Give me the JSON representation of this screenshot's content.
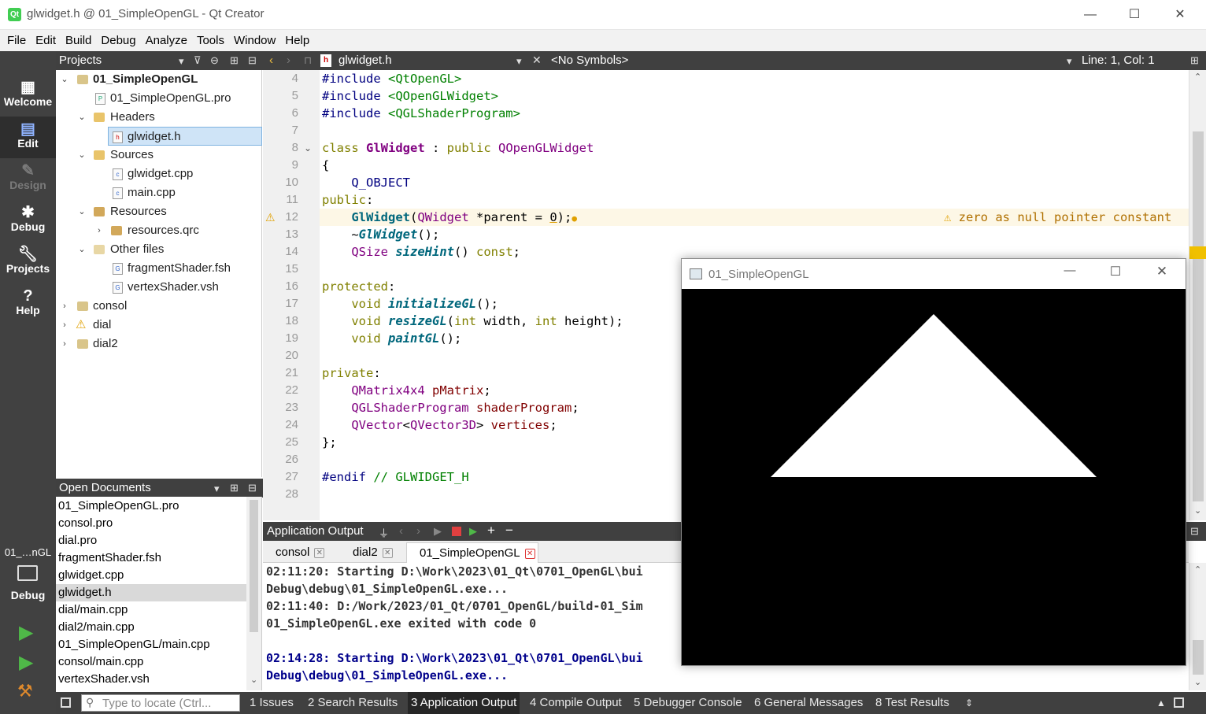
{
  "window": {
    "title": "glwidget.h @ 01_SimpleOpenGL - Qt Creator",
    "app_icon_text": "Qt"
  },
  "menu": [
    "File",
    "Edit",
    "Build",
    "Debug",
    "Analyze",
    "Tools",
    "Window",
    "Help"
  ],
  "modes": [
    {
      "label": "Welcome",
      "icon": "grid-icon"
    },
    {
      "label": "Edit",
      "icon": "edit-icon"
    },
    {
      "label": "Design",
      "icon": "pencil-icon"
    },
    {
      "label": "Debug",
      "icon": "bug-icon"
    },
    {
      "label": "Projects",
      "icon": "wrench-icon"
    },
    {
      "label": "Help",
      "icon": "help-icon"
    }
  ],
  "kit_selector": {
    "project": "01_…nGL",
    "mode": "Debug"
  },
  "projects_panel": {
    "title": "Projects",
    "tree": [
      {
        "label": "01_SimpleOpenGL",
        "level": 0,
        "bold": true,
        "expanded": true
      },
      {
        "label": "01_SimpleOpenGL.pro",
        "level": 1
      },
      {
        "label": "Headers",
        "level": 1,
        "expanded": true
      },
      {
        "label": "glwidget.h",
        "level": 2,
        "selected": true
      },
      {
        "label": "Sources",
        "level": 1,
        "expanded": true
      },
      {
        "label": "glwidget.cpp",
        "level": 2
      },
      {
        "label": "main.cpp",
        "level": 2
      },
      {
        "label": "Resources",
        "level": 1,
        "expanded": true
      },
      {
        "label": "resources.qrc",
        "level": 2
      },
      {
        "label": "Other files",
        "level": 1,
        "expanded": true
      },
      {
        "label": "fragmentShader.fsh",
        "level": 2
      },
      {
        "label": "vertexShader.vsh",
        "level": 2
      },
      {
        "label": "consol",
        "level": 0
      },
      {
        "label": "dial",
        "level": 0,
        "warning": true
      },
      {
        "label": "dial2",
        "level": 0
      }
    ]
  },
  "open_documents": {
    "title": "Open Documents",
    "items": [
      "01_SimpleOpenGL.pro",
      "consol.pro",
      "dial.pro",
      "fragmentShader.fsh",
      "glwidget.cpp",
      "glwidget.h",
      "dial/main.cpp",
      "dial2/main.cpp",
      "01_SimpleOpenGL/main.cpp",
      "consol/main.cpp",
      "vertexShader.vsh"
    ],
    "selected": "glwidget.h"
  },
  "editor_toolbar": {
    "file": "glwidget.h",
    "symbols": "<No Symbols>",
    "position": "Line: 1, Col: 1"
  },
  "editor": {
    "line_numbers": [
      "4",
      "5",
      "6",
      "7",
      "8",
      "9",
      "10",
      "11",
      "12",
      "13",
      "14",
      "15",
      "16",
      "17",
      "18",
      "19",
      "20",
      "21",
      "22",
      "23",
      "24",
      "25",
      "26",
      "27",
      "28"
    ],
    "warning_text": "zero as null pointer constant"
  },
  "output_pane": {
    "title": "Application Output",
    "tabs": [
      "consol",
      "dial2",
      "01_SimpleOpenGL"
    ],
    "lines": [
      {
        "text": "02:11:20: Starting D:\\Work\\2023\\01_Qt\\0701_OpenGL\\bui",
        "color": "#333333"
      },
      {
        "text": "Debug\\debug\\01_SimpleOpenGL.exe...",
        "color": "#333333"
      },
      {
        "text": "02:11:40: D:/Work/2023/01_Qt/0701_OpenGL/build-01_Sim",
        "color": "#333333"
      },
      {
        "text": "01_SimpleOpenGL.exe exited with code 0",
        "color": "#333333"
      },
      {
        "text": "",
        "color": "#333333"
      },
      {
        "text": "02:14:28: Starting D:\\Work\\2023\\01_Qt\\0701_OpenGL\\bui",
        "color": "#00008b"
      },
      {
        "text": "Debug\\debug\\01_SimpleOpenGL.exe...",
        "color": "#00008b"
      }
    ]
  },
  "status_bar": {
    "locator_placeholder": "Type to locate (Ctrl...",
    "panes": [
      "1  Issues",
      "2  Search Results",
      "3  Application Output",
      "4  Compile Output",
      "5  Debugger Console",
      "6  General Messages",
      "8  Test Results"
    ]
  },
  "gl_window": {
    "title": "01_SimpleOpenGL",
    "background": "#000000",
    "triangle_color": "#ffffff"
  },
  "colors": {
    "modebar": "#414141",
    "selection": "#cfe4f7",
    "warning": "#f0a000"
  }
}
